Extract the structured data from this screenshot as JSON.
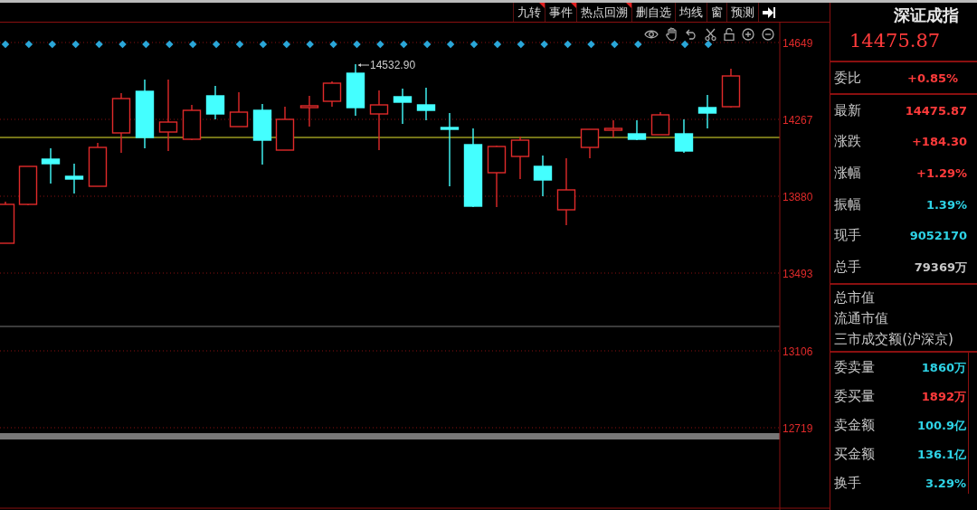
{
  "toolbar": {
    "buttons": [
      {
        "label": "九转",
        "flagged": true
      },
      {
        "label": "事件",
        "flagged": true
      },
      {
        "label": "热点回溯",
        "flagged": true
      },
      {
        "label": "删自选",
        "flagged": false
      },
      {
        "label": "均线",
        "flagged": false
      },
      {
        "label": "窗",
        "flagged": false
      },
      {
        "label": "预测",
        "flagged": false
      }
    ]
  },
  "chart": {
    "high_label": "14532.90",
    "price_ticks": [
      "14649",
      "14267",
      "13880",
      "13493",
      "13106",
      "12719"
    ]
  },
  "quote": {
    "name": "深证成指",
    "price": "14475.87",
    "ratio": {
      "label": "委比",
      "value": "+0.85%",
      "color": "#ff3b3b"
    },
    "rows": [
      {
        "label": "最新",
        "value": "14475.87",
        "color": "#ff3b3b"
      },
      {
        "label": "涨跌",
        "value": "+184.30",
        "color": "#ff3b3b"
      },
      {
        "label": "涨幅",
        "value": "+1.29%",
        "color": "#ff3b3b"
      },
      {
        "label": "振幅",
        "value": "1.39%",
        "color": "#2ed3e6"
      },
      {
        "label": "现手",
        "value": "9052170",
        "color": "#2ed3e6"
      },
      {
        "label": "总手",
        "value": "79369万",
        "color": "#c8c8c8"
      }
    ],
    "market_labels": [
      "总市值",
      "流通市值",
      "三市成交额(沪深京)"
    ],
    "orders": [
      {
        "label": "委卖量",
        "value": "1860万",
        "color": "#2ed3e6"
      },
      {
        "label": "委买量",
        "value": "1892万",
        "color": "#ff3b3b"
      },
      {
        "label": "卖金额",
        "value": "100.9亿",
        "color": "#2ed3e6"
      },
      {
        "label": "买金额",
        "value": "136.1亿",
        "color": "#2ed3e6"
      },
      {
        "label": "换手",
        "value": "3.29%",
        "color": "#2ed3e6"
      }
    ]
  }
}
